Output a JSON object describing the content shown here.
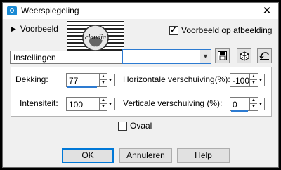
{
  "window": {
    "title": "Weerspiegeling",
    "close_glyph": "✕"
  },
  "preview": {
    "toggle_label": "Voorbeeld",
    "thumbnail_text": "claudia",
    "show_on_image_label": "Voorbeeld op afbeelding",
    "show_on_image_checked": true
  },
  "settings": {
    "label": "Instellingen",
    "selected": "",
    "tools": [
      "save-icon",
      "randomize-icon",
      "reset-icon"
    ]
  },
  "params": {
    "opacity_label": "Dekking:",
    "opacity_value": "77",
    "intensity_label": "Intensiteit:",
    "intensity_value": "100",
    "h_offset_label": "Horizontale verschuiving(%):",
    "h_offset_value": "-100",
    "v_offset_label": "Verticale verschuiving (%):",
    "v_offset_value": "0"
  },
  "oval": {
    "label": "Ovaal",
    "checked": false
  },
  "buttons": {
    "ok": "OK",
    "cancel": "Annuleren",
    "help": "Help"
  },
  "colors": {
    "accent": "#0078d7",
    "title_icon": "#1a8ad4"
  }
}
